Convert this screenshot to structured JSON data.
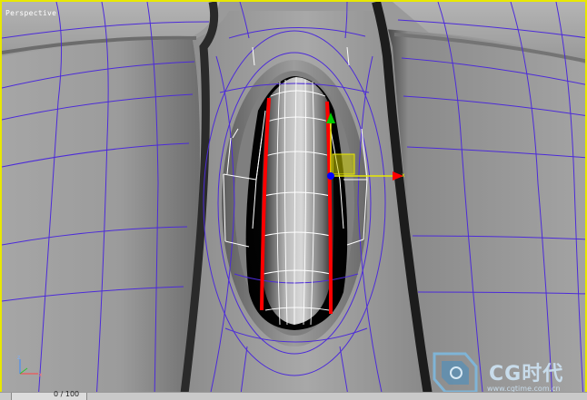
{
  "viewport": {
    "label": "Perspective",
    "border_color": "#e8e800",
    "wire_color": "#4c2bd9",
    "selected_edge_color": "#ff0000",
    "cage_color": "#ffffff"
  },
  "gizmo": {
    "x_label": "x",
    "x_color": "#e8e800",
    "y_color": "#00cc00",
    "plane_color": "#c8c800",
    "pivot_color": "#0000ff",
    "arrow_color": "#ff0000"
  },
  "axis_tripod": {
    "x": "x",
    "z": "z",
    "icon": "axis-tripod-icon"
  },
  "watermark": {
    "brand": "CG时代",
    "url": "www.cgtime.com.cn",
    "icon": "cg-logo-icon"
  },
  "timeline": {
    "frame_counter": "0 / 100"
  }
}
